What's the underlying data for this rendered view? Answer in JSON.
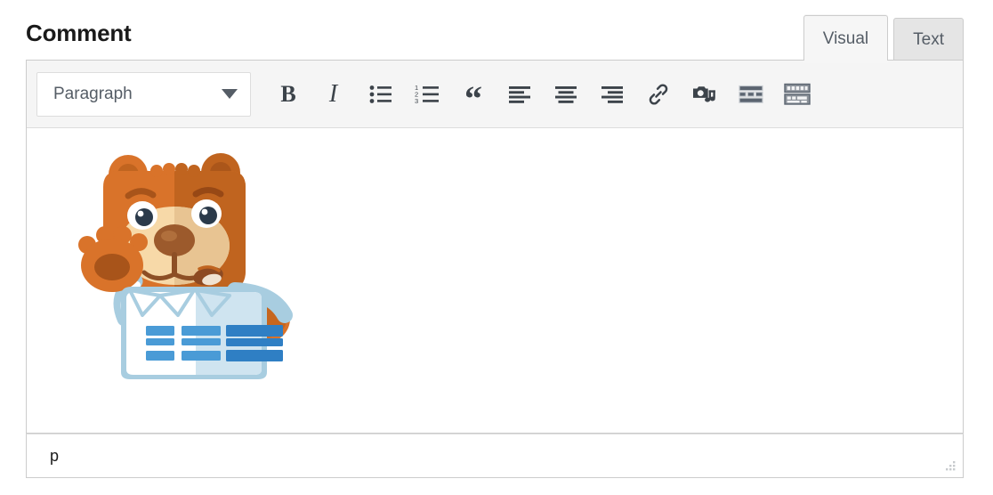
{
  "page": {
    "title": "Comment"
  },
  "tabs": [
    {
      "label": "Visual",
      "name": "tab-visual",
      "active": true
    },
    {
      "label": "Text",
      "name": "tab-text",
      "active": false
    }
  ],
  "toolbar": {
    "format_select": {
      "value": "Paragraph",
      "caret_icon": "chevron-down-icon"
    },
    "buttons": [
      {
        "name": "bold-button",
        "icon": "bold-icon",
        "label": "B"
      },
      {
        "name": "italic-button",
        "icon": "italic-icon",
        "label": "I"
      },
      {
        "name": "bulleted-list-button",
        "icon": "bulleted-list-icon",
        "label": ""
      },
      {
        "name": "numbered-list-button",
        "icon": "numbered-list-icon",
        "label": ""
      },
      {
        "name": "blockquote-button",
        "icon": "blockquote-icon",
        "label": "“"
      },
      {
        "name": "align-left-button",
        "icon": "align-left-icon",
        "label": ""
      },
      {
        "name": "align-center-button",
        "icon": "align-center-icon",
        "label": ""
      },
      {
        "name": "align-right-button",
        "icon": "align-right-icon",
        "label": ""
      },
      {
        "name": "insert-link-button",
        "icon": "link-icon",
        "label": ""
      },
      {
        "name": "add-media-button",
        "icon": "media-camera-music-icon",
        "label": ""
      },
      {
        "name": "insert-read-more-button",
        "icon": "read-more-icon",
        "label": ""
      },
      {
        "name": "toolbar-toggle-button",
        "icon": "keyboard-toolbar-toggle-icon",
        "label": ""
      }
    ],
    "numbered_list_digits": [
      "1",
      "2",
      "3"
    ]
  },
  "content": {
    "image_alt": "waving cartoon bear mascot holding a document",
    "colors": {
      "bear_body": "#d9732a",
      "bear_body_dark": "#b85c1e",
      "bear_muzzle": "#f7d9a8",
      "bear_nose": "#9c5a2c",
      "shirt": "#ffffff",
      "shirt_shade": "#cfe4f0",
      "shirt_outline": "#a8cde0",
      "bar_blue": "#2f7fc4",
      "bar_blue_light": "#4a9bd6"
    }
  },
  "statusbar": {
    "path": "p",
    "resize_handle": "resize-grip-icon"
  },
  "theme": {
    "border": "#cccccc",
    "toolbar_bg": "#f5f5f5",
    "tab_inactive_bg": "#e5e5e5",
    "tab_active_bg": "#f6f6f6",
    "icon_color": "#50575e",
    "text_color": "#555d66"
  }
}
